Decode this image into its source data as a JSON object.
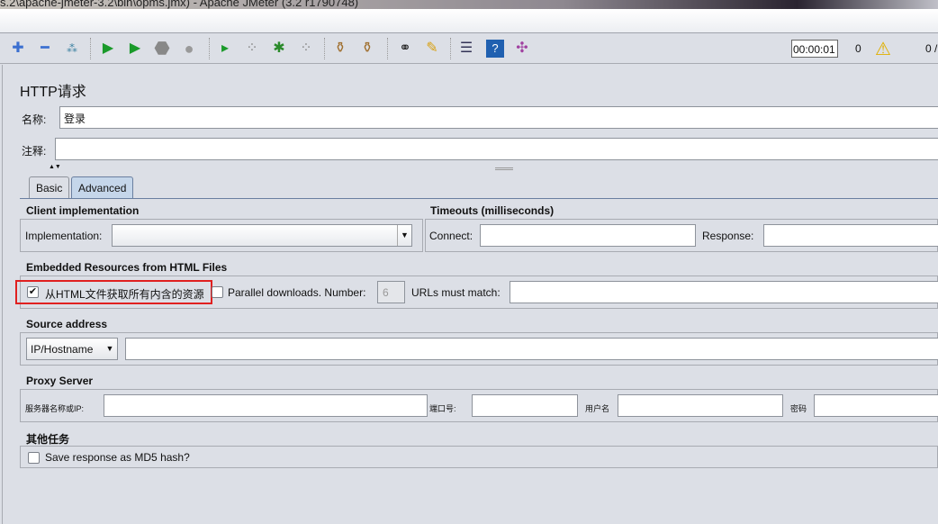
{
  "window": {
    "title": "s.2\\apache-jmeter-3.2\\bin\\opms.jmx) - Apache JMeter (3.2 r1790748)"
  },
  "toolbar": {
    "icons": [
      "add-icon",
      "remove-icon",
      "toggle-icon",
      "start-icon",
      "start-no-pause-icon",
      "stop-icon",
      "shutdown-icon",
      "remote-start-icon",
      "remote-stop-icon",
      "remote-debug-icon",
      "remote-shutdown-icon",
      "clear-icon",
      "clear-all-icon",
      "search-icon",
      "reset-search-icon",
      "function-helper-icon",
      "help-icon",
      "remote-icon"
    ],
    "timer": "00:00:01",
    "warning_count": "0",
    "threads": "0 /"
  },
  "panel": {
    "title": "HTTP请求",
    "name_label": "名称:",
    "name_value": "登录",
    "comment_label": "注释:",
    "comment_value": ""
  },
  "tabs": [
    {
      "label": "Basic"
    },
    {
      "label": "Advanced"
    }
  ],
  "client": {
    "title": "Client implementation",
    "impl_label": "Implementation:",
    "impl_value": ""
  },
  "timeouts": {
    "title": "Timeouts (milliseconds)",
    "connect_label": "Connect:",
    "response_label": "Response:"
  },
  "embedded": {
    "title": "Embedded Resources from HTML Files",
    "retrieve_label": "从HTML文件获取所有内含的资源",
    "retrieve_checked": true,
    "parallel_label": "Parallel downloads. Number:",
    "parallel_checked": false,
    "parallel_number": "6",
    "urls_label": "URLs must match:",
    "highlight_color": "#e02020"
  },
  "source": {
    "title": "Source address",
    "type_value": "IP/Hostname"
  },
  "proxy": {
    "title": "Proxy Server",
    "server_label": "服务器名称或IP:",
    "port_label": "端口号:",
    "user_label": "用户名",
    "password_label": "密码"
  },
  "other": {
    "title": "其他任务",
    "md5_label": "Save response as MD5 hash?",
    "md5_checked": false
  }
}
